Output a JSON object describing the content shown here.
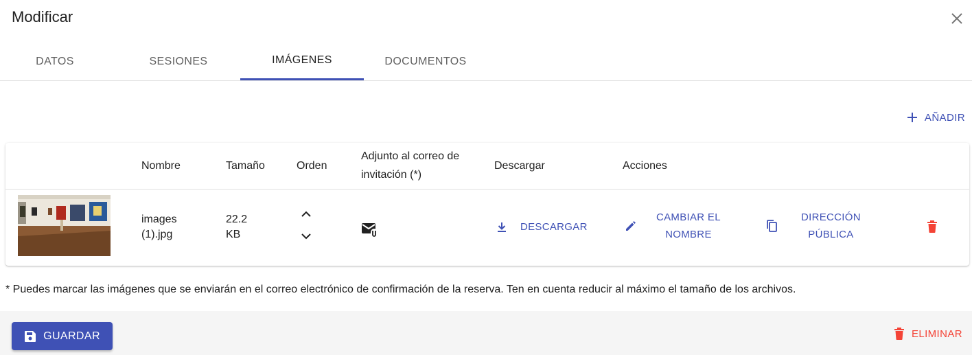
{
  "dialog": {
    "title": "Modificar"
  },
  "tabs": [
    {
      "label": "DATOS"
    },
    {
      "label": "SESIONES"
    },
    {
      "label": "IMÁGENES",
      "active": true
    },
    {
      "label": "DOCUMENTOS"
    }
  ],
  "toolbar": {
    "add_label": "AÑADIR"
  },
  "table": {
    "headers": {
      "name": "Nombre",
      "size": "Tamaño",
      "order": "Orden",
      "attach_line1": "Adjunto al correo de",
      "attach_line2": "invitación (*)",
      "download": "Descargar",
      "actions": "Acciones"
    },
    "rows": [
      {
        "name_line1": "images",
        "name_line2": "(1).jpg",
        "size_line1": "22.2",
        "size_line2": "KB",
        "download_label": "DESCARGAR",
        "rename_line1": "CAMBIAR EL",
        "rename_line2": "NOMBRE",
        "public_line1": "DIRECCIÓN",
        "public_line2": "PÚBLICA"
      }
    ]
  },
  "footnote": "* Puedes marcar las imágenes que se enviarán en el correo electrónico de confirmación de la reserva. Ten en cuenta reducir al máximo el tamaño de los archivos.",
  "footer": {
    "save_label": "GUARDAR",
    "delete_label": "ELIMINAR"
  },
  "colors": {
    "primary": "#3f51b5",
    "danger": "#f44336",
    "footer_bg": "#f5f5f5"
  },
  "icons": [
    "close-icon",
    "plus-icon",
    "chevron-up-icon",
    "chevron-down-icon",
    "email-attachment-icon",
    "download-icon",
    "pencil-icon",
    "copy-icon",
    "trash-icon",
    "save-icon"
  ]
}
